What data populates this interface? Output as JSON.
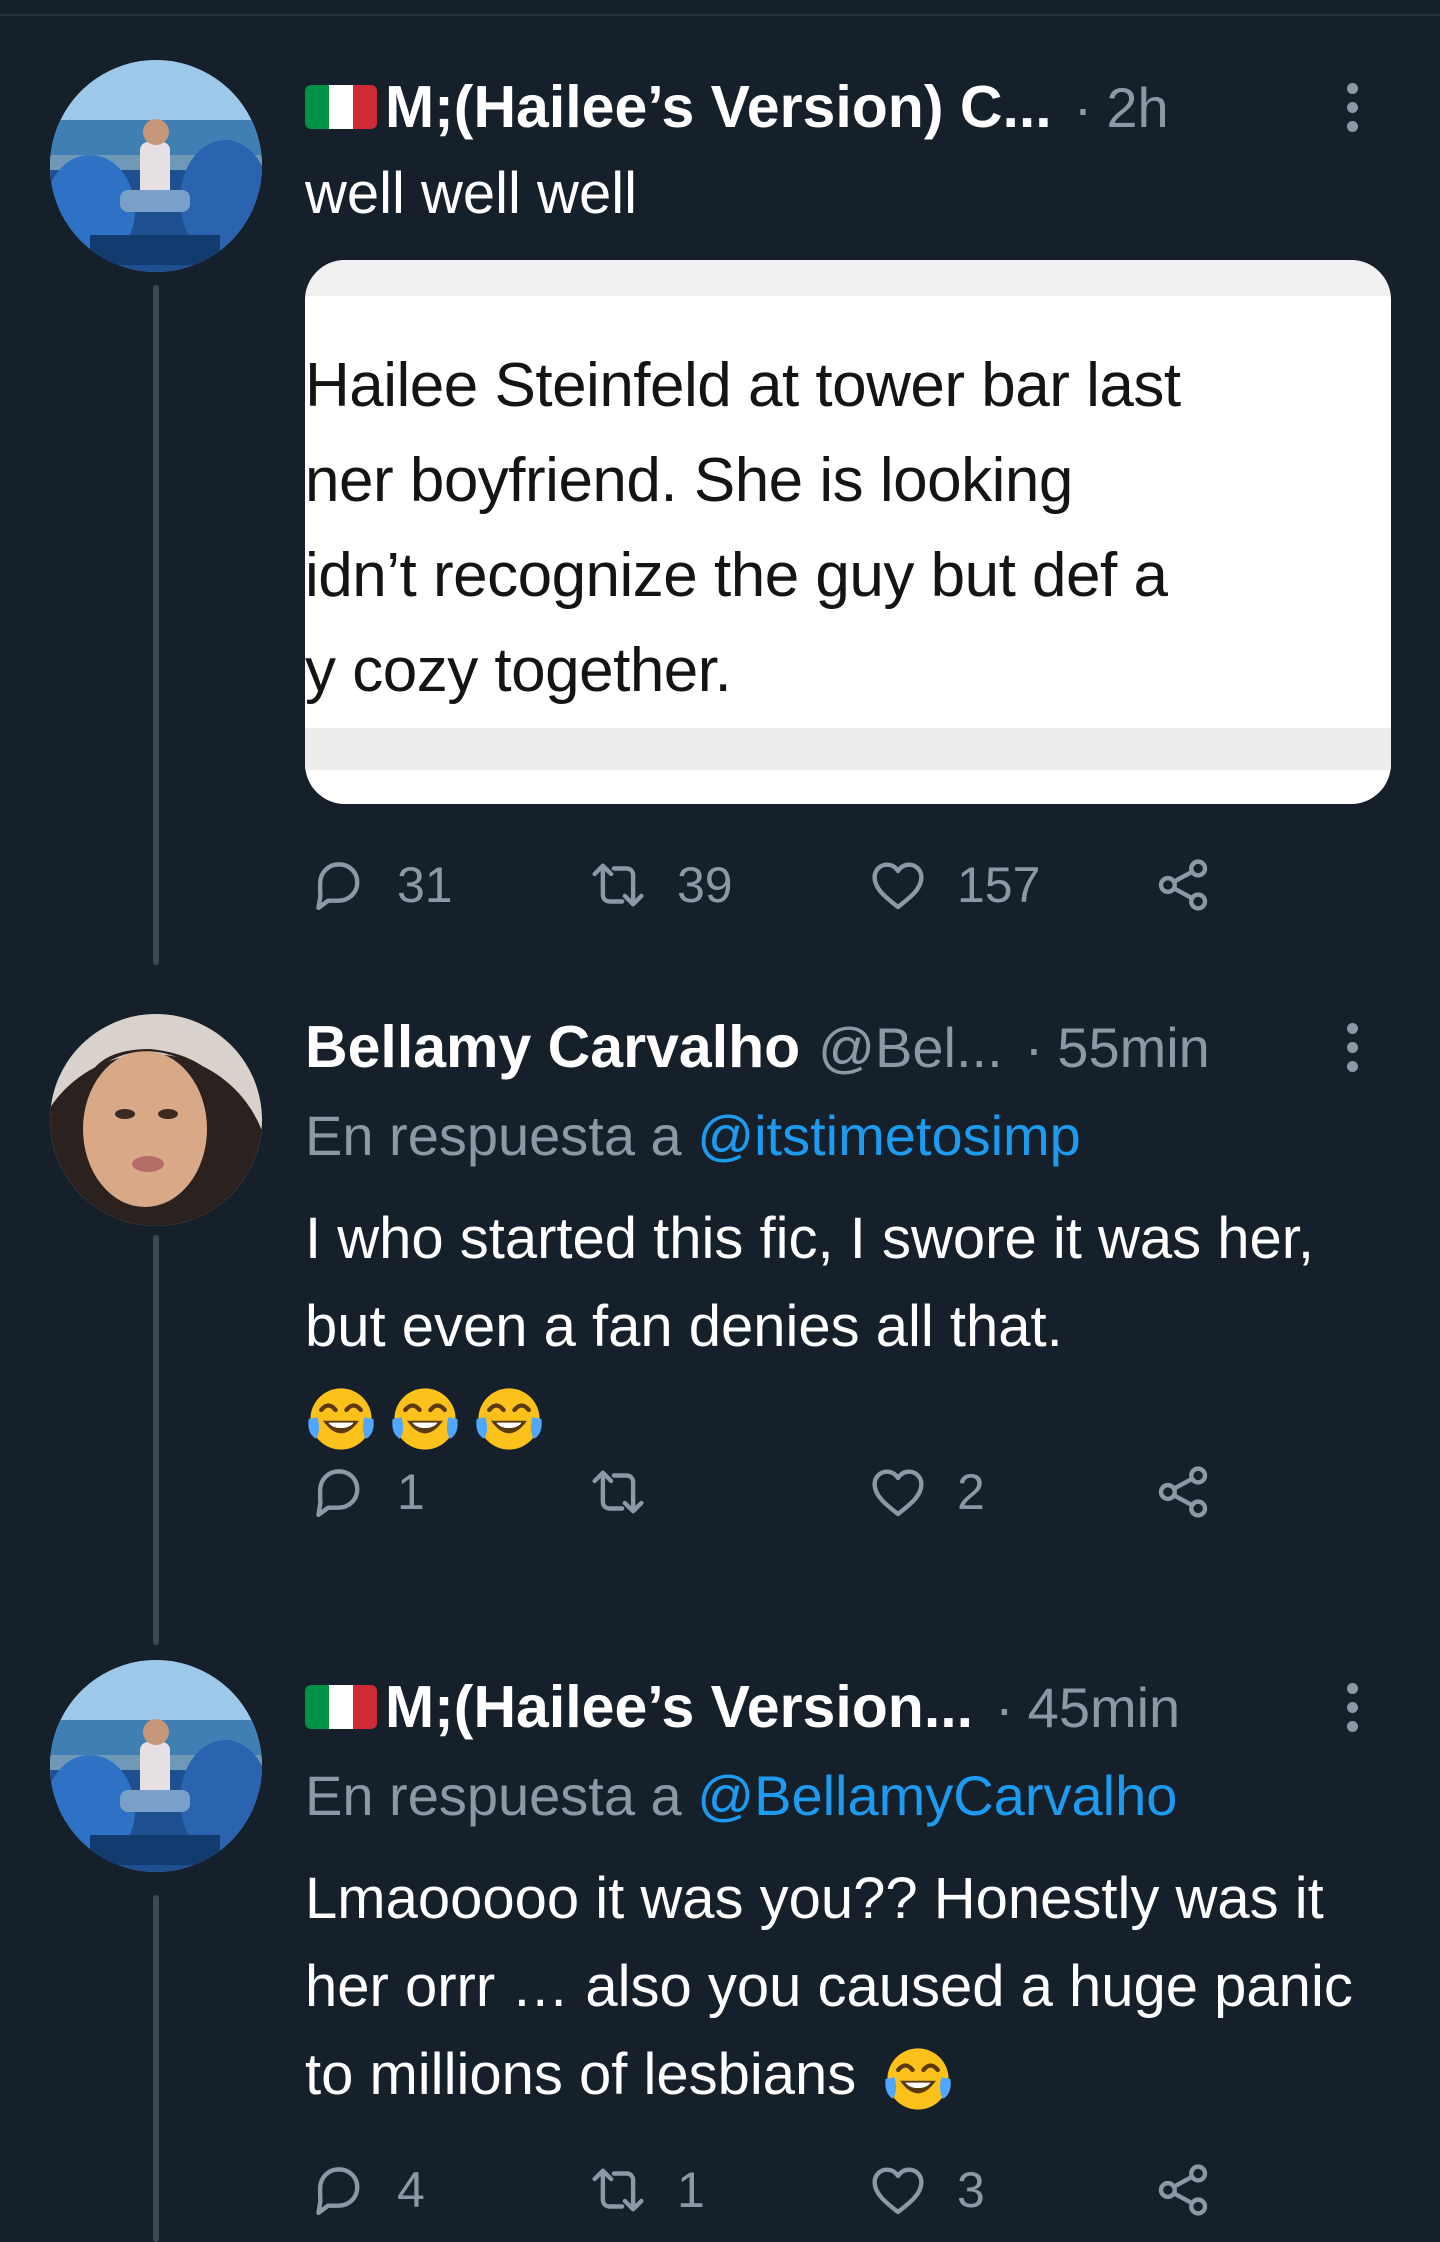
{
  "tweets": [
    {
      "name": "M;(Hailee’s Version) C...",
      "handle": "",
      "time": "2h",
      "text": "well well well",
      "media_lines": [
        "Hailee Steinfeld at tower bar last",
        "ner boyfriend. She is looking",
        "idn’t recognize the guy but def a",
        "y cozy together."
      ],
      "replies": "31",
      "retweets": "39",
      "likes": "157",
      "flag_colors": [
        "#009246",
        "#ffffff",
        "#ce2b37"
      ]
    },
    {
      "name": "Bellamy Carvalho",
      "handle": "@Bel...",
      "time": "55min",
      "reply_prefix": "En respuesta a ",
      "reply_mention": "@itstimetosimp",
      "text": "I who started this fic, I swore it was her, but even a fan denies all that.",
      "emojis": [
        "face-with-tears-of-joy",
        "face-with-tears-of-joy",
        "face-with-tears-of-joy"
      ],
      "replies": "1",
      "retweets": "",
      "likes": "2"
    },
    {
      "name": "M;(Hailee’s Version...",
      "handle": "",
      "time": "45min",
      "reply_prefix": "En respuesta a ",
      "reply_mention": "@BellamyCarvalho",
      "text": "Lmaooooo it was you?? Honestly was it her orrr … also you caused a huge panic to millions of lesbians",
      "emojis": [
        "face-with-tears-of-joy"
      ],
      "replies": "4",
      "retweets": "1",
      "likes": "3",
      "flag_colors": [
        "#009246",
        "#ffffff",
        "#ce2b37"
      ]
    }
  ],
  "colors": {
    "background": "#15202b",
    "secondary_text": "#8b98a5",
    "link": "#1d9bf0",
    "thread_line": "#3d4a56"
  },
  "icons": [
    "reply-icon",
    "retweet-icon",
    "like-icon",
    "share-icon",
    "more-icon"
  ]
}
